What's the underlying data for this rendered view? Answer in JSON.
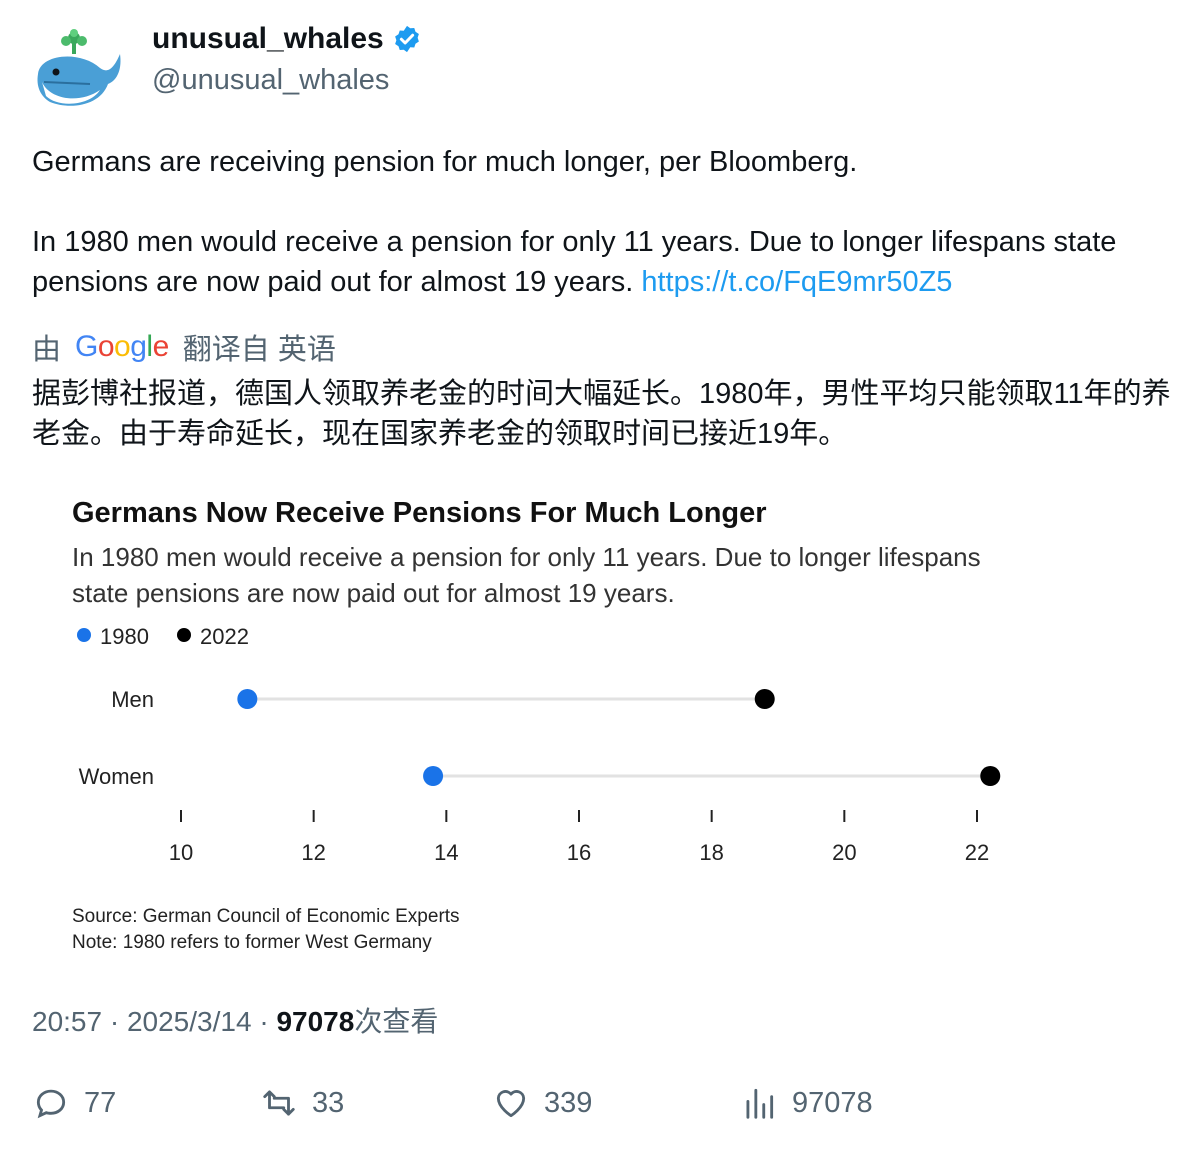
{
  "colors": {
    "link": "#1d9bf0",
    "verified": "#1d9bf0",
    "muted": "#536471",
    "series_1980": "#1a73e8",
    "series_2022": "#000000"
  },
  "author": {
    "display_name": "unusual_whales",
    "handle": "@unusual_whales",
    "avatar_icon": "whale-logo-icon",
    "verified_icon": "verified-badge-icon"
  },
  "tweet": {
    "line1": "Germans are receiving pension for much longer, per Bloomberg.",
    "line2": "In 1980 men would receive a pension for only 11 years. Due to longer lifespans state pensions are now paid out for almost 19 years.",
    "link": "https://t.co/FqE9mr50Z5"
  },
  "translation": {
    "prefix": "由",
    "brand": "Google",
    "suffix": "翻译自 英语",
    "text": "据彭博社报道，德国人领取养老金的时间大幅延长。1980年，男性平均只能领取11年的养老金。由于寿命延长，现在国家养老金的领取时间已接近19年。"
  },
  "chart_data": {
    "type": "scatter",
    "title": "Germans Now Receive Pensions For Much Longer",
    "subtitle": "In 1980 men would receive a pension for only 11 years. Due to longer lifespans state pensions are now paid out for almost 19 years.",
    "categories": [
      "Men",
      "Women"
    ],
    "series": [
      {
        "name": "1980",
        "color": "#1a73e8",
        "values": [
          11.0,
          13.8
        ]
      },
      {
        "name": "2022",
        "color": "#000000",
        "values": [
          18.8,
          22.2
        ]
      }
    ],
    "x_ticks": [
      "10",
      "12",
      "14",
      "16",
      "18",
      "20",
      "22"
    ],
    "xlim": [
      10,
      22
    ],
    "grid": false,
    "legend": "top-left",
    "source": "Source: German Council of Economic Experts",
    "note": "Note: 1980 refers to former West Germany"
  },
  "meta": {
    "time": "20:57",
    "date": "2025/3/14",
    "views": "97078",
    "views_label": "次查看",
    "sep": "·"
  },
  "actions": {
    "replies": "77",
    "reposts": "33",
    "likes": "339",
    "views": "97078"
  }
}
